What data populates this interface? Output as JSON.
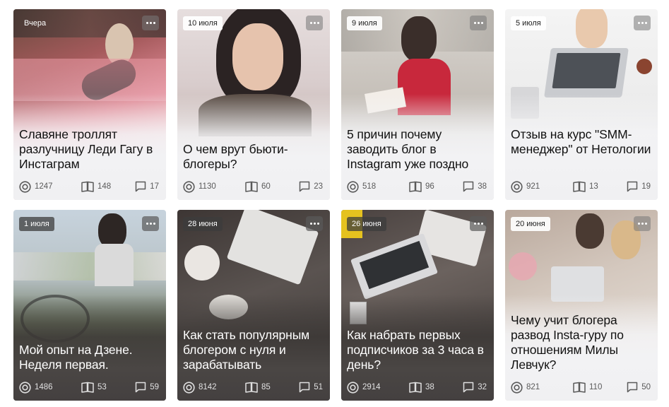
{
  "cards": [
    {
      "date": "Вчера",
      "title": "Славяне троллят разлучницу Леди Гагу в Инстаграм",
      "views": "1247",
      "reads": "148",
      "comments": "17"
    },
    {
      "date": "10 июля",
      "title": "О чем врут бьюти-блогеры?",
      "views": "1130",
      "reads": "60",
      "comments": "23"
    },
    {
      "date": "9 июля",
      "title": "5 причин почему заводить блог в Instagram уже поздно",
      "views": "518",
      "reads": "96",
      "comments": "38"
    },
    {
      "date": "5 июля",
      "title": "Отзыв на курс \"SMM-менеджер\" от Нетологии",
      "views": "921",
      "reads": "13",
      "comments": "19"
    },
    {
      "date": "1 июля",
      "title": "Мой опыт на Дзене. Неделя первая.",
      "views": "1486",
      "reads": "53",
      "comments": "59"
    },
    {
      "date": "28 июня",
      "title": "Как стать популярным блогером с нуля и зарабатывать",
      "views": "8142",
      "reads": "85",
      "comments": "51"
    },
    {
      "date": "26 июня",
      "title": "Как набрать первых подписчиков за 3 часа в день?",
      "views": "2914",
      "reads": "38",
      "comments": "32"
    },
    {
      "date": "20 июня",
      "title": "Чему учит блогера развод Insta-гуру по отношениям Милы Левчук?",
      "views": "821",
      "reads": "110",
      "comments": "50"
    }
  ],
  "icons": {
    "views": "eye-icon",
    "reads": "book-icon",
    "comments": "comment-icon",
    "more": "more-dots-icon"
  },
  "colors": {
    "light_text": "#111111",
    "dark_text": "#ffffff",
    "stat_light": "#5a5a5a",
    "stat_dark": "#e0e0e0"
  }
}
